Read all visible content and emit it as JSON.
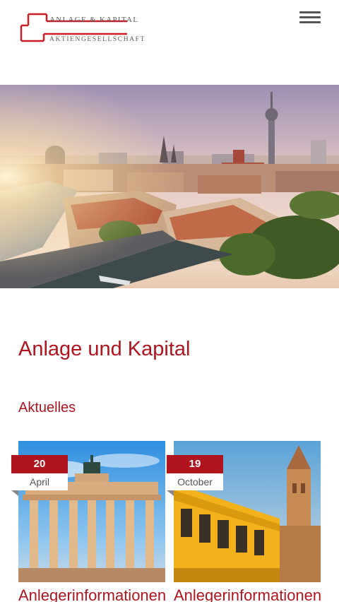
{
  "header": {
    "logo_line1": "ANLAGE & KAPITAL",
    "logo_line2": "AKTIENGESELLSCHAFT",
    "menu_icon": "hamburger-menu-icon"
  },
  "hero": {
    "image": "berlin-skyline-photo"
  },
  "main": {
    "title": "Anlage und Kapital",
    "section_title": "Aktuelles"
  },
  "news": [
    {
      "day": "20",
      "month": "April",
      "title": "Anlegerinformationen",
      "image": "brandenburg-gate-photo"
    },
    {
      "day": "19",
      "month": "October",
      "title": "Anlegerinformationen",
      "image": "oberbaum-bridge-ubahn-photo"
    }
  ],
  "colors": {
    "brand_red": "#b0141e",
    "text_gray": "#555555"
  }
}
